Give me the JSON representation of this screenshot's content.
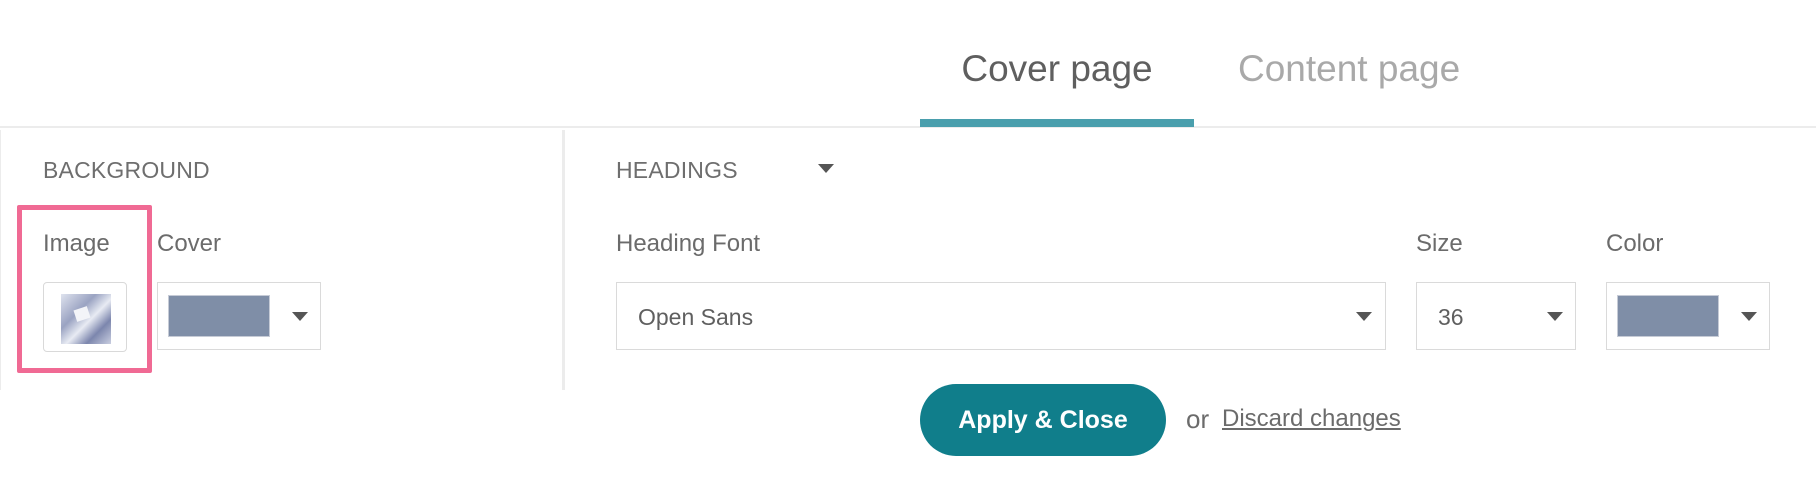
{
  "tabs": [
    {
      "label": "Cover page",
      "active": true
    },
    {
      "label": "Content page",
      "active": false
    }
  ],
  "background": {
    "title": "BACKGROUND",
    "image_label": "Image",
    "cover_label": "Cover",
    "cover_color": "#7f8ea7"
  },
  "headings": {
    "title": "HEADINGS",
    "font_label": "Heading Font",
    "font_value": "Open Sans",
    "size_label": "Size",
    "size_value": "36",
    "color_label": "Color",
    "color_value": "#7f8ea7"
  },
  "actions": {
    "apply_label": "Apply & Close",
    "or_text": "or",
    "discard_label": "Discard changes"
  },
  "colors": {
    "accent": "#4a9fad",
    "button": "#107e8b",
    "highlight": "#f06a94"
  }
}
